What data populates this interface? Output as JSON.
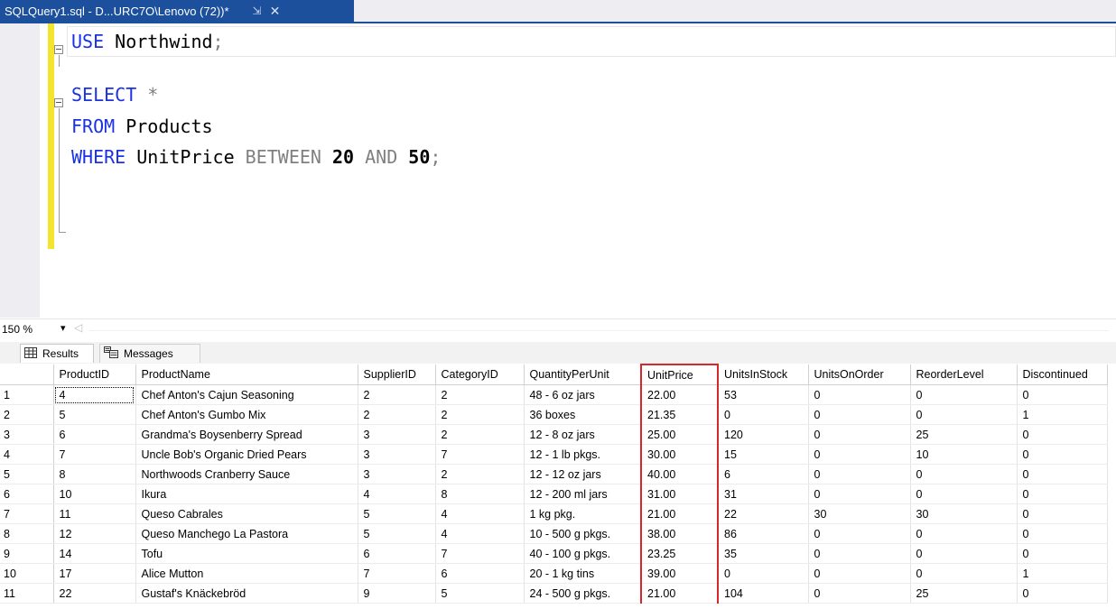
{
  "tab": {
    "title": "SQLQuery1.sql - D...URC7O\\Lenovo (72))*",
    "pin_icon": "⇲",
    "close_icon": "✕"
  },
  "editor": {
    "lines": [
      {
        "keyword": "USE",
        "rest": " Northwind",
        "end": ";"
      },
      {
        "keyword": "SELECT",
        "op": " *"
      },
      {
        "keyword": "FROM",
        "rest": " Products"
      },
      {
        "keyword": "WHERE",
        "rest": " UnitPrice ",
        "between": "BETWEEN",
        "n1": " 20",
        "and": " AND",
        "n2": " 50",
        "end": ";"
      }
    ]
  },
  "zoom": {
    "level": "150 %",
    "arrow": "▾",
    "scroll_left": "◁"
  },
  "results": {
    "tabs": [
      {
        "label": "Results",
        "icon": "grid-icon"
      },
      {
        "label": "Messages",
        "icon": "messages-icon"
      }
    ],
    "columns": [
      "ProductID",
      "ProductName",
      "SupplierID",
      "CategoryID",
      "QuantityPerUnit",
      "UnitPrice",
      "UnitsInStock",
      "UnitsOnOrder",
      "ReorderLevel",
      "Discontinued"
    ],
    "rows": [
      [
        "1",
        "4",
        "Chef Anton's Cajun Seasoning",
        "2",
        "2",
        "48 - 6 oz jars",
        "22.00",
        "53",
        "0",
        "0",
        "0"
      ],
      [
        "2",
        "5",
        "Chef Anton's Gumbo Mix",
        "2",
        "2",
        "36 boxes",
        "21.35",
        "0",
        "0",
        "0",
        "1"
      ],
      [
        "3",
        "6",
        "Grandma's Boysenberry Spread",
        "3",
        "2",
        "12 - 8 oz jars",
        "25.00",
        "120",
        "0",
        "25",
        "0"
      ],
      [
        "4",
        "7",
        "Uncle Bob's Organic Dried Pears",
        "3",
        "7",
        "12 - 1 lb pkgs.",
        "30.00",
        "15",
        "0",
        "10",
        "0"
      ],
      [
        "5",
        "8",
        "Northwoods Cranberry Sauce",
        "3",
        "2",
        "12 - 12 oz jars",
        "40.00",
        "6",
        "0",
        "0",
        "0"
      ],
      [
        "6",
        "10",
        "Ikura",
        "4",
        "8",
        "12 - 200 ml jars",
        "31.00",
        "31",
        "0",
        "0",
        "0"
      ],
      [
        "7",
        "11",
        "Queso Cabrales",
        "5",
        "4",
        "1 kg pkg.",
        "21.00",
        "22",
        "30",
        "30",
        "0"
      ],
      [
        "8",
        "12",
        "Queso Manchego La Pastora",
        "5",
        "4",
        "10 - 500 g pkgs.",
        "38.00",
        "86",
        "0",
        "0",
        "0"
      ],
      [
        "9",
        "14",
        "Tofu",
        "6",
        "7",
        "40 - 100 g pkgs.",
        "23.25",
        "35",
        "0",
        "0",
        "0"
      ],
      [
        "10",
        "17",
        "Alice Mutton",
        "7",
        "6",
        "20 - 1 kg tins",
        "39.00",
        "0",
        "0",
        "0",
        "1"
      ],
      [
        "11",
        "22",
        "Gustaf's Knäckebröd",
        "9",
        "5",
        "24 - 500 g pkgs.",
        "21.00",
        "104",
        "0",
        "25",
        "0"
      ]
    ]
  },
  "colors": {
    "tab_accent": "#1c4f9c",
    "keyword": "#1a31e6",
    "change_bar": "#f4e42d",
    "highlight_border": "#d6282b"
  }
}
